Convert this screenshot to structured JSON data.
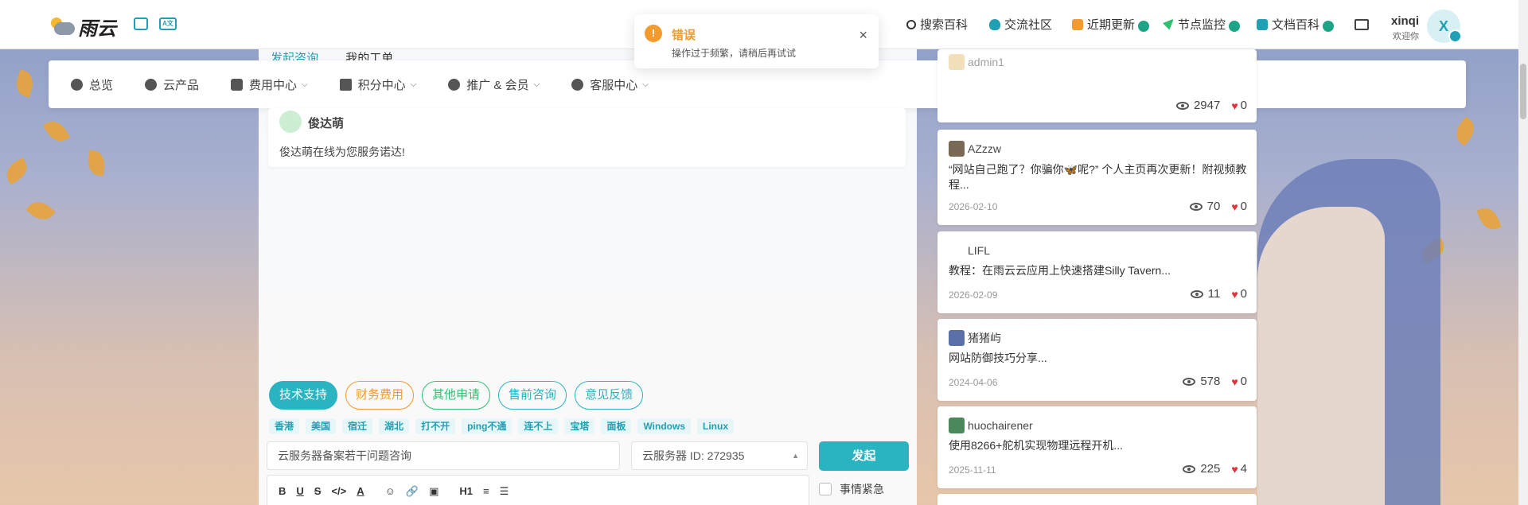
{
  "brand": {
    "logo_text": "雨云"
  },
  "header": {
    "icons": [
      "gallery-icon",
      "translate-icon"
    ],
    "translate_label": "A文",
    "nav": [
      {
        "label": "搜索百科",
        "icon": "search-icon",
        "badge": false
      },
      {
        "label": "交流社区",
        "icon": "community-icon",
        "badge": false
      },
      {
        "label": "近期更新",
        "icon": "update-icon",
        "badge": true
      },
      {
        "label": "节点监控",
        "icon": "send-icon",
        "badge": true
      },
      {
        "label": "文档百科",
        "icon": "book-icon",
        "badge": true
      }
    ],
    "user": {
      "name": "xinqi",
      "subtitle": "欢迎你",
      "avatar_letter": "X"
    }
  },
  "menu": [
    {
      "label": "总览",
      "icon": "dashboard-icon",
      "dropdown": false
    },
    {
      "label": "云产品",
      "icon": "cubes-icon",
      "dropdown": false
    },
    {
      "label": "费用中心",
      "icon": "money-icon",
      "dropdown": true
    },
    {
      "label": "积分中心",
      "icon": "gift-icon",
      "dropdown": true
    },
    {
      "label": "推广 & 会员",
      "icon": "users-icon",
      "dropdown": true
    },
    {
      "label": "客服中心",
      "icon": "headset-icon",
      "dropdown": true
    }
  ],
  "toast": {
    "title": "错误",
    "message": "操作过于频繁，请稍后再试试",
    "icon_glyph": "!",
    "close_glyph": "×"
  },
  "ticket": {
    "tabs_partial": [
      "发起咨询",
      "我的工单"
    ],
    "agent_name": "俊达萌",
    "agent_message": "俊达萌在线为您服务诺达!",
    "categories": [
      {
        "label": "技术支持",
        "active": true,
        "color": "#2ab3c0"
      },
      {
        "label": "财务费用",
        "active": false,
        "color": "#f29b2e"
      },
      {
        "label": "其他申请",
        "active": false,
        "color": "#2fbf71"
      },
      {
        "label": "售前咨询",
        "active": false,
        "color": "#2ab3c0"
      },
      {
        "label": "意见反馈",
        "active": false,
        "color": "#2ab3c0"
      }
    ],
    "tags": [
      "香港",
      "美国",
      "宿迁",
      "湖北",
      "打不开",
      "ping不通",
      "连不上",
      "宝塔",
      "面板",
      "Windows",
      "Linux"
    ],
    "title_value": "云服务器备案若干问题咨询",
    "server_select": "云服务器 ID: 272935",
    "send_label": "发起",
    "urgent_label": "事情紧急",
    "editor_tools": [
      "B",
      "U",
      "S",
      "</>",
      "A",
      "☺",
      "🔗",
      "▣",
      "H1",
      "≡",
      "☰"
    ]
  },
  "feed": [
    {
      "author": "admin1",
      "body": "",
      "date": "",
      "views": "2947",
      "likes": "0",
      "partial": true
    },
    {
      "author": "AZzzw",
      "body": "“网站自己跑了？你骗你🦋呢?” 个人主页再次更新！附视频教程...",
      "date": "2026-02-10",
      "views": "70",
      "likes": "0"
    },
    {
      "author": "LIFL",
      "body": "教程：在雨云云应用上快速搭建Silly Tavern...",
      "date": "2026-02-09",
      "views": "11",
      "likes": "0"
    },
    {
      "author": "猪猪屿",
      "body": "网站防御技巧分享...",
      "date": "2024-04-06",
      "views": "578",
      "likes": "0"
    },
    {
      "author": "huochairener",
      "body": "使用8266+舵机实现物理远程开机...",
      "date": "2025-11-11",
      "views": "225",
      "likes": "4"
    }
  ],
  "colors": {
    "accent": "#2ab3c0",
    "warning": "#f29b2e",
    "like": "#e0343d"
  }
}
